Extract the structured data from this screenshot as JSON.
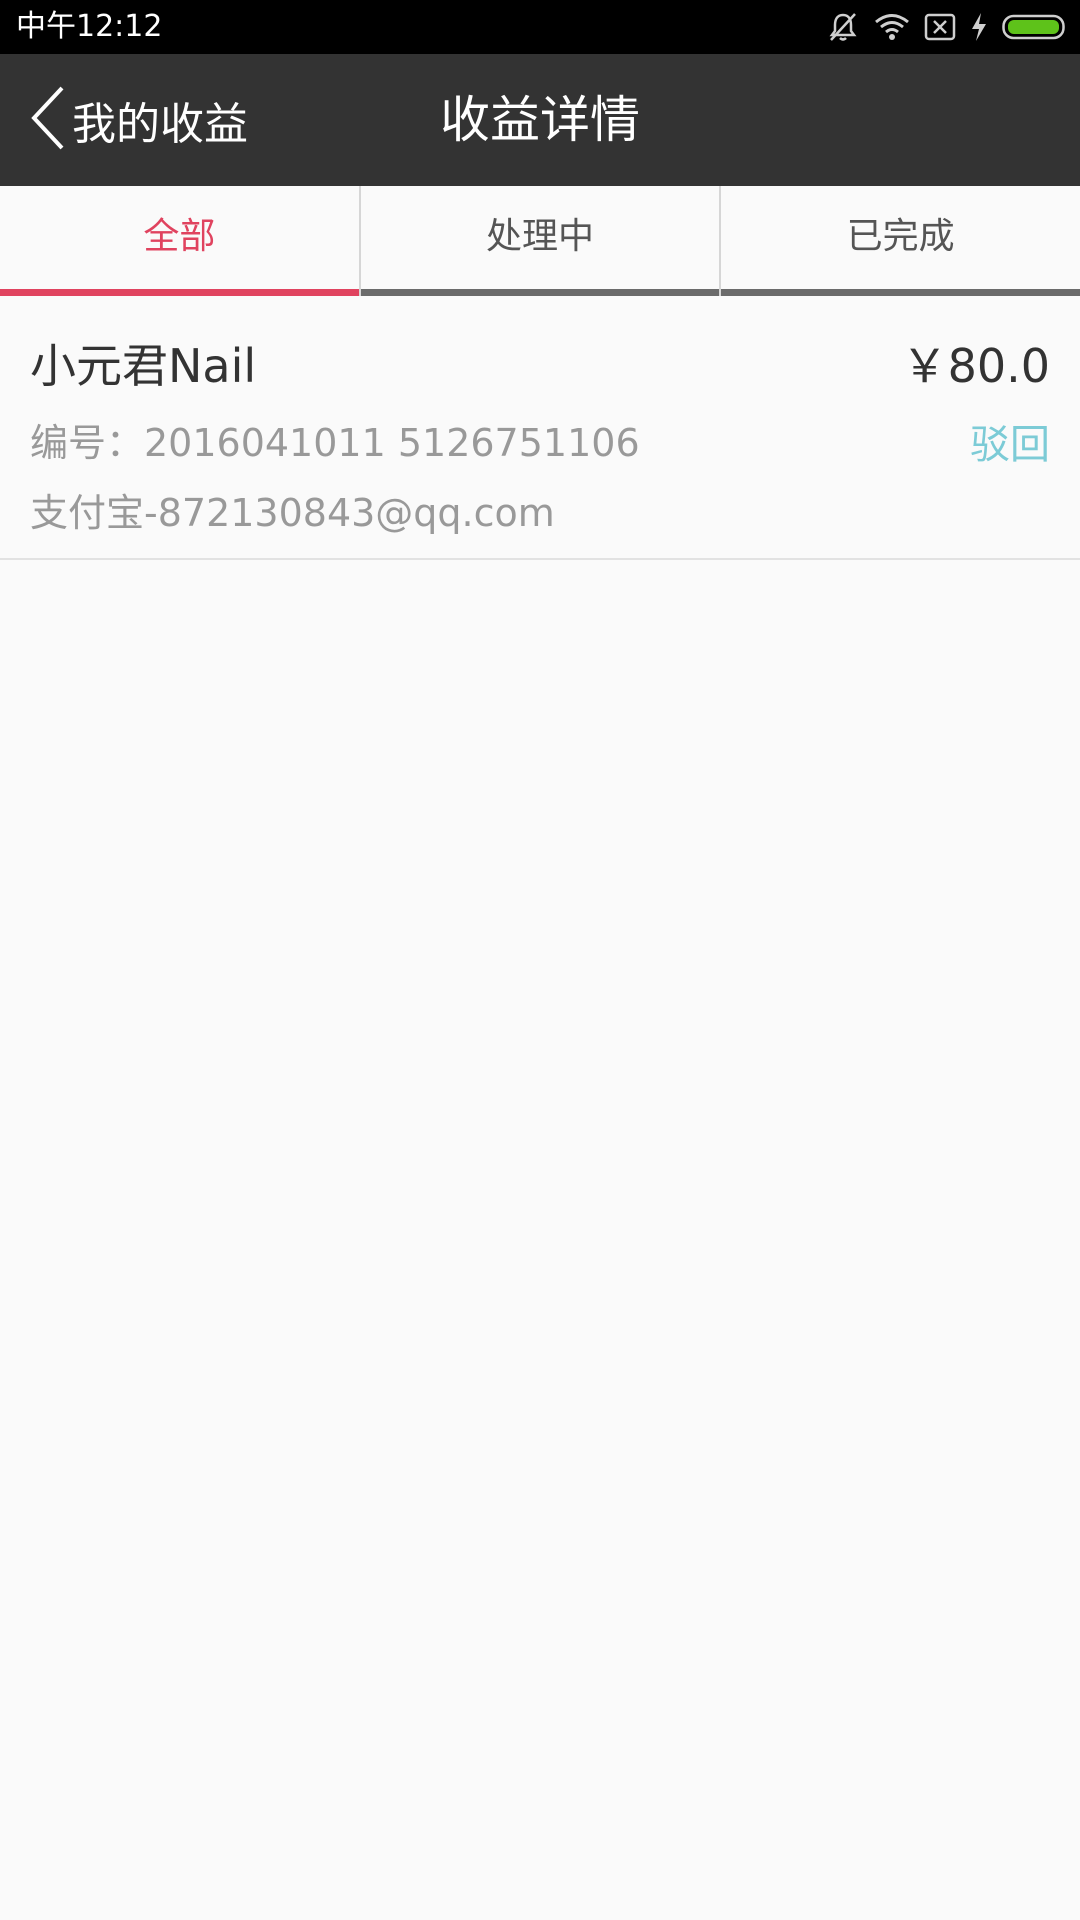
{
  "status_bar": {
    "time": "中午12:12",
    "icons": [
      "mute-bell-icon",
      "wifi-icon",
      "no-sim-icon",
      "charging-bolt-icon",
      "battery-icon"
    ],
    "battery_color": "#5ec21a"
  },
  "header": {
    "back_label": "我的收益",
    "title": "收益详情"
  },
  "tabs": [
    {
      "label": "全部",
      "active": true
    },
    {
      "label": "处理中",
      "active": false
    },
    {
      "label": "已完成",
      "active": false
    }
  ],
  "records": [
    {
      "name": "小元君Nail",
      "amount": "￥80.0",
      "number": "编号：2016041011 5126751106",
      "status": "驳回",
      "account": "支付宝-872130843@qq.com"
    }
  ],
  "colors": {
    "accent": "#e0435f",
    "status_rejected": "#7ccbd6",
    "header_bg": "#333333"
  }
}
